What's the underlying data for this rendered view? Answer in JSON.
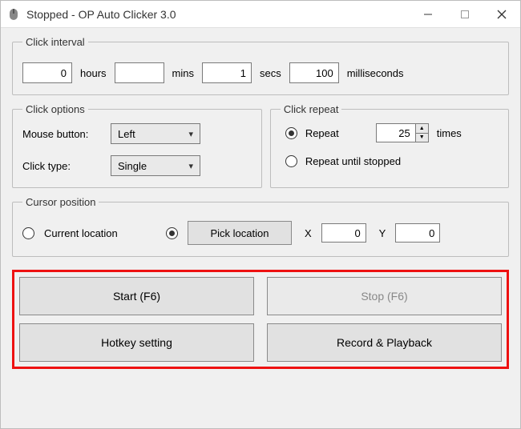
{
  "titlebar": {
    "title": "Stopped - OP Auto Clicker 3.0"
  },
  "interval": {
    "legend": "Click interval",
    "hours_value": "0",
    "hours_label": "hours",
    "mins_value": "",
    "mins_label": "mins",
    "secs_value": "1",
    "secs_label": "secs",
    "ms_value": "100",
    "ms_label": "milliseconds"
  },
  "options": {
    "legend": "Click options",
    "mouse_label": "Mouse button:",
    "mouse_value": "Left",
    "type_label": "Click type:",
    "type_value": "Single"
  },
  "repeat": {
    "legend": "Click repeat",
    "repeat_label": "Repeat",
    "repeat_value": "25",
    "times_label": "times",
    "until_label": "Repeat until stopped"
  },
  "cursor": {
    "legend": "Cursor position",
    "current_label": "Current location",
    "pick_label": "Pick location",
    "x_label": "X",
    "x_value": "0",
    "y_label": "Y",
    "y_value": "0"
  },
  "actions": {
    "start": "Start (F6)",
    "stop": "Stop (F6)",
    "hotkey": "Hotkey setting",
    "record": "Record & Playback"
  }
}
